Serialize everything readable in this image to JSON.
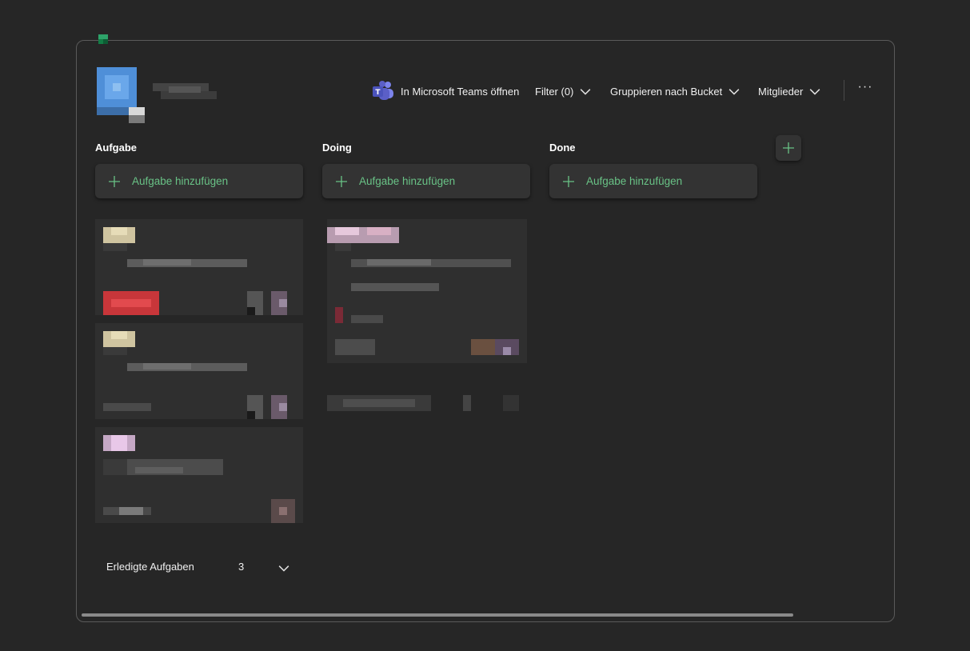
{
  "toolbar": {
    "teams_label": "In Microsoft Teams öffnen",
    "filter_label": "Filter (0)",
    "group_label": "Gruppieren nach Bucket",
    "members_label": "Mitglieder",
    "more_label": "···"
  },
  "buckets": [
    {
      "title": "Aufgabe",
      "add_label": "Aufgabe hinzufügen"
    },
    {
      "title": "Doing",
      "add_label": "Aufgabe hinzufügen"
    },
    {
      "title": "Done",
      "add_label": "Aufgabe hinzufügen"
    }
  ],
  "completed": {
    "label": "Erledigte Aufgaben",
    "count": "3"
  },
  "colors": {
    "accent_green": "#69c286",
    "background": "#262626",
    "card": "#2f2f2f",
    "teams_purple": "#5b5fc7"
  }
}
